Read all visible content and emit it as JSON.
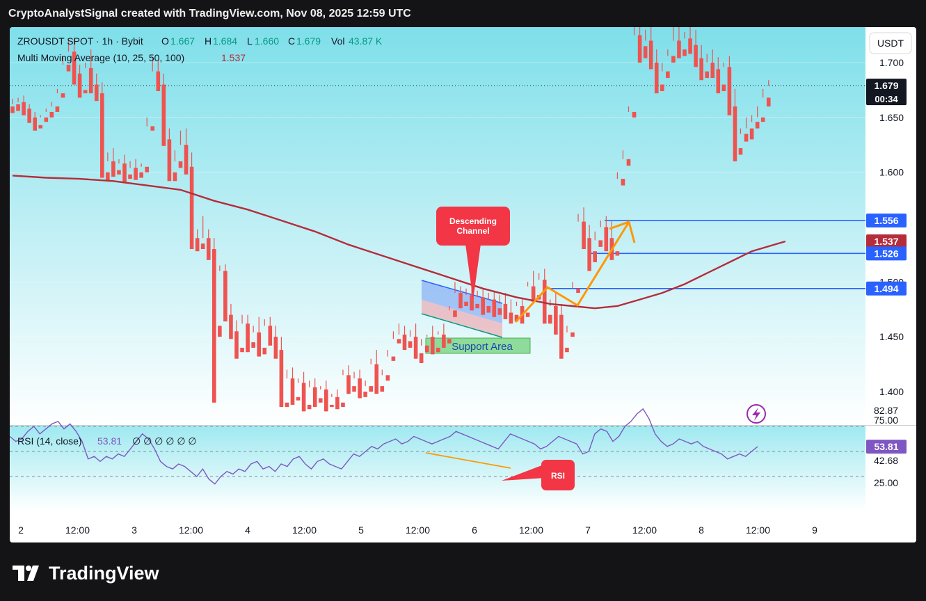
{
  "header": {
    "title": "CryptoAnalystSignal created with TradingView.com, Nov 08, 2025 12:59 UTC"
  },
  "legend": {
    "symbol": "ZROUSDT SPOT · 1h · Bybit",
    "o_label": "O",
    "o_value": "1.667",
    "h_label": "H",
    "h_value": "1.684",
    "l_label": "L",
    "l_value": "1.660",
    "c_label": "C",
    "c_value": "1.679",
    "vol_label": "Vol",
    "vol_value": "43.87 K",
    "ma_label": "Multi Moving Average (10, 25, 50, 100)",
    "ma_value": "1.537"
  },
  "currency_button": "USDT",
  "price_axis": {
    "ticks": [
      "1.700",
      "1.650",
      "1.600",
      "1.500",
      "1.450",
      "1.400"
    ]
  },
  "price_badges": {
    "last_price": "1.679",
    "countdown": "00:34",
    "level_1": "1.556",
    "ma": "1.537",
    "level_2": "1.526",
    "level_3": "1.494"
  },
  "rsi": {
    "label": "RSI (14, close)",
    "value": "53.81",
    "extras": "∅ ∅ ∅ ∅ ∅ ∅",
    "axis": [
      "82.87",
      "75.00",
      "42.68",
      "25.00"
    ],
    "badge": "53.81"
  },
  "time_axis": [
    "2",
    "12:00",
    "3",
    "12:00",
    "4",
    "12:00",
    "5",
    "12:00",
    "6",
    "12:00",
    "7",
    "12:00",
    "8",
    "12:00",
    "9"
  ],
  "annotations": {
    "descending_channel": "Descending Channel",
    "support_area": "Support Area",
    "rsi_callout": "RSI"
  },
  "footer": {
    "brand": "TradingView"
  },
  "colors": {
    "bull": "#26a69a",
    "bear": "#ef5350",
    "ma_line": "#b52c3a",
    "level_line": "#2962ff",
    "rsi_line": "#7e57c2",
    "bg_top": "#7fdde8",
    "arrow": "#ff9800",
    "callout": "#f23645"
  },
  "chart_data": {
    "type": "candlestick",
    "title": "ZROUSDT SPOT · 1h · Bybit",
    "ylim": [
      1.385,
      1.735
    ],
    "x_ticks": [
      "2",
      "12:00",
      "3",
      "12:00",
      "4",
      "12:00",
      "5",
      "12:00",
      "6",
      "12:00",
      "7",
      "12:00",
      "8",
      "12:00",
      "9"
    ],
    "candles": [
      [
        1.66,
        1.667,
        1.662,
        1.654
      ],
      [
        1.662,
        1.668,
        1.664,
        1.656
      ],
      [
        1.664,
        1.67,
        1.658,
        1.652
      ],
      [
        1.658,
        1.662,
        1.65,
        1.645
      ],
      [
        1.65,
        1.655,
        1.643,
        1.638
      ],
      [
        1.643,
        1.652,
        1.65,
        1.64
      ],
      [
        1.65,
        1.658,
        1.655,
        1.646
      ],
      [
        1.655,
        1.664,
        1.66,
        1.65
      ],
      [
        1.66,
        1.676,
        1.672,
        1.655
      ],
      [
        1.672,
        1.705,
        1.698,
        1.668
      ],
      [
        1.698,
        1.72,
        1.71,
        1.692
      ],
      [
        1.71,
        1.722,
        1.69,
        1.68
      ],
      [
        1.69,
        1.698,
        1.675,
        1.668
      ],
      [
        1.675,
        1.7,
        1.695,
        1.672
      ],
      [
        1.695,
        1.712,
        1.68,
        1.672
      ],
      [
        1.68,
        1.69,
        1.672,
        1.665
      ],
      [
        1.672,
        1.682,
        1.6,
        1.595
      ],
      [
        1.6,
        1.618,
        1.61,
        1.592
      ],
      [
        1.61,
        1.622,
        1.602,
        1.596
      ],
      [
        1.602,
        1.612,
        1.608,
        1.598
      ],
      [
        1.608,
        1.616,
        1.598,
        1.59
      ],
      [
        1.598,
        1.61,
        1.604,
        1.594
      ],
      [
        1.604,
        1.612,
        1.6,
        1.593
      ],
      [
        1.6,
        1.608,
        1.605,
        1.595
      ],
      [
        1.605,
        1.65,
        1.642,
        1.6
      ],
      [
        1.642,
        1.705,
        1.692,
        1.638
      ],
      [
        1.692,
        1.702,
        1.68,
        1.674
      ],
      [
        1.68,
        1.69,
        1.63,
        1.624
      ],
      [
        1.63,
        1.64,
        1.6,
        1.592
      ],
      [
        1.6,
        1.62,
        1.61,
        1.592
      ],
      [
        1.61,
        1.638,
        1.625,
        1.604
      ],
      [
        1.625,
        1.64,
        1.605,
        1.598
      ],
      [
        1.605,
        1.618,
        1.54,
        1.53
      ],
      [
        1.54,
        1.548,
        1.535,
        1.528
      ],
      [
        1.535,
        1.56,
        1.54,
        1.53
      ],
      [
        1.54,
        1.548,
        1.53,
        1.52
      ],
      [
        1.53,
        1.54,
        1.46,
        1.39
      ],
      [
        1.46,
        1.515,
        1.51,
        1.45
      ],
      [
        1.51,
        1.516,
        1.47,
        1.464
      ],
      [
        1.47,
        1.48,
        1.455,
        1.448
      ],
      [
        1.455,
        1.465,
        1.44,
        1.43
      ],
      [
        1.44,
        1.47,
        1.462,
        1.436
      ],
      [
        1.462,
        1.47,
        1.445,
        1.436
      ],
      [
        1.445,
        1.46,
        1.454,
        1.44
      ],
      [
        1.454,
        1.468,
        1.44,
        1.432
      ],
      [
        1.44,
        1.466,
        1.46,
        1.434
      ],
      [
        1.46,
        1.468,
        1.45,
        1.442
      ],
      [
        1.45,
        1.46,
        1.438,
        1.43
      ],
      [
        1.438,
        1.45,
        1.39,
        1.386
      ],
      [
        1.39,
        1.42,
        1.412,
        1.386
      ],
      [
        1.412,
        1.422,
        1.395,
        1.388
      ],
      [
        1.395,
        1.412,
        1.408,
        1.392
      ],
      [
        1.408,
        1.418,
        1.388,
        1.382
      ],
      [
        1.388,
        1.41,
        1.404,
        1.384
      ],
      [
        1.404,
        1.412,
        1.394,
        1.386
      ],
      [
        1.394,
        1.405,
        1.402,
        1.39
      ],
      [
        1.402,
        1.41,
        1.388,
        1.382
      ],
      [
        1.388,
        1.398,
        1.395,
        1.386
      ],
      [
        1.395,
        1.402,
        1.39,
        1.384
      ],
      [
        1.39,
        1.42,
        1.415,
        1.386
      ],
      [
        1.415,
        1.424,
        1.405,
        1.398
      ],
      [
        1.405,
        1.418,
        1.412,
        1.4
      ],
      [
        1.412,
        1.42,
        1.4,
        1.394
      ],
      [
        1.4,
        1.41,
        1.405,
        1.395
      ],
      [
        1.405,
        1.43,
        1.425,
        1.4
      ],
      [
        1.425,
        1.438,
        1.405,
        1.398
      ],
      [
        1.405,
        1.42,
        1.415,
        1.4
      ],
      [
        1.415,
        1.438,
        1.432,
        1.41
      ],
      [
        1.432,
        1.455,
        1.448,
        1.428
      ],
      [
        1.448,
        1.462,
        1.452,
        1.444
      ],
      [
        1.452,
        1.46,
        1.446,
        1.438
      ],
      [
        1.446,
        1.456,
        1.45,
        1.44
      ],
      [
        1.45,
        1.462,
        1.435,
        1.43
      ],
      [
        1.435,
        1.448,
        1.442,
        1.426
      ],
      [
        1.442,
        1.452,
        1.45,
        1.436
      ],
      [
        1.45,
        1.46,
        1.44,
        1.434
      ],
      [
        1.44,
        1.455,
        1.452,
        1.436
      ],
      [
        1.452,
        1.462,
        1.448,
        1.44
      ],
      [
        1.448,
        1.478,
        1.474,
        1.444
      ],
      [
        1.474,
        1.5,
        1.49,
        1.468
      ],
      [
        1.49,
        1.496,
        1.482,
        1.476
      ],
      [
        1.482,
        1.494,
        1.488,
        1.478
      ],
      [
        1.488,
        1.495,
        1.48,
        1.474
      ],
      [
        1.48,
        1.492,
        1.486,
        1.476
      ],
      [
        1.486,
        1.494,
        1.478,
        1.47
      ],
      [
        1.478,
        1.49,
        1.484,
        1.472
      ],
      [
        1.484,
        1.492,
        1.476,
        1.468
      ],
      [
        1.476,
        1.488,
        1.48,
        1.47
      ],
      [
        1.48,
        1.49,
        1.472,
        1.466
      ],
      [
        1.472,
        1.484,
        1.47,
        1.462
      ],
      [
        1.47,
        1.482,
        1.478,
        1.464
      ],
      [
        1.478,
        1.486,
        1.472,
        1.462
      ],
      [
        1.472,
        1.5,
        1.496,
        1.468
      ],
      [
        1.496,
        1.51,
        1.488,
        1.482
      ],
      [
        1.488,
        1.508,
        1.502,
        1.484
      ],
      [
        1.502,
        1.512,
        1.47,
        1.462
      ],
      [
        1.47,
        1.484,
        1.478,
        1.462
      ],
      [
        1.478,
        1.49,
        1.47,
        1.452
      ],
      [
        1.47,
        1.48,
        1.44,
        1.43
      ],
      [
        1.44,
        1.46,
        1.454,
        1.436
      ],
      [
        1.454,
        1.5,
        1.494,
        1.45
      ],
      [
        1.494,
        1.562,
        1.555,
        1.49
      ],
      [
        1.555,
        1.568,
        1.54,
        1.53
      ],
      [
        1.54,
        1.552,
        1.528,
        1.51
      ],
      [
        1.528,
        1.546,
        1.538,
        1.518
      ],
      [
        1.538,
        1.556,
        1.55,
        1.532
      ],
      [
        1.55,
        1.56,
        1.54,
        1.528
      ],
      [
        1.54,
        1.556,
        1.528,
        1.52
      ],
      [
        1.528,
        1.6,
        1.594,
        1.524
      ],
      [
        1.594,
        1.62,
        1.612,
        1.588
      ],
      [
        1.612,
        1.66,
        1.655,
        1.606
      ],
      [
        1.655,
        1.735,
        1.725,
        1.65
      ],
      [
        1.725,
        1.74,
        1.715,
        1.7
      ],
      [
        1.715,
        1.73,
        1.72,
        1.704
      ],
      [
        1.72,
        1.735,
        1.7,
        1.694
      ],
      [
        1.7,
        1.712,
        1.68,
        1.672
      ],
      [
        1.68,
        1.7,
        1.692,
        1.674
      ],
      [
        1.692,
        1.712,
        1.706,
        1.686
      ],
      [
        1.706,
        1.735,
        1.72,
        1.7
      ],
      [
        1.72,
        1.736,
        1.712,
        1.704
      ],
      [
        1.712,
        1.728,
        1.722,
        1.706
      ],
      [
        1.722,
        1.734,
        1.716,
        1.708
      ],
      [
        1.716,
        1.73,
        1.704,
        1.696
      ],
      [
        1.704,
        1.716,
        1.692,
        1.684
      ],
      [
        1.692,
        1.708,
        1.7,
        1.686
      ],
      [
        1.7,
        1.712,
        1.694,
        1.686
      ],
      [
        1.694,
        1.705,
        1.68,
        1.672
      ],
      [
        1.68,
        1.7,
        1.696,
        1.674
      ],
      [
        1.696,
        1.706,
        1.66,
        1.652
      ],
      [
        1.66,
        1.676,
        1.622,
        1.61
      ],
      [
        1.622,
        1.64,
        1.635,
        1.616
      ],
      [
        1.635,
        1.65,
        1.64,
        1.628
      ],
      [
        1.64,
        1.652,
        1.646,
        1.63
      ],
      [
        1.646,
        1.66,
        1.65,
        1.64
      ],
      [
        1.65,
        1.676,
        1.668,
        1.646
      ],
      [
        1.668,
        1.684,
        1.679,
        1.66
      ]
    ],
    "moving_average": [
      [
        0,
        1.597
      ],
      [
        6,
        1.595
      ],
      [
        12,
        1.594
      ],
      [
        18,
        1.592
      ],
      [
        24,
        1.588
      ],
      [
        30,
        1.584
      ],
      [
        36,
        1.574
      ],
      [
        42,
        1.566
      ],
      [
        48,
        1.556
      ],
      [
        54,
        1.546
      ],
      [
        60,
        1.534
      ],
      [
        66,
        1.524
      ],
      [
        72,
        1.514
      ],
      [
        78,
        1.504
      ],
      [
        84,
        1.494
      ],
      [
        90,
        1.486
      ],
      [
        96,
        1.48
      ],
      [
        100,
        1.478
      ],
      [
        104,
        1.476
      ],
      [
        108,
        1.478
      ],
      [
        112,
        1.484
      ],
      [
        116,
        1.49
      ],
      [
        120,
        1.498
      ],
      [
        124,
        1.508
      ],
      [
        128,
        1.518
      ],
      [
        132,
        1.528
      ],
      [
        138,
        1.537
      ]
    ],
    "levels": [
      1.556,
      1.526,
      1.494
    ],
    "rsi": {
      "name": "RSI (14, close)",
      "ylim": [
        20,
        90
      ],
      "upper": 70,
      "middle": 50,
      "lower": 30,
      "values": [
        62,
        58,
        60,
        66,
        70,
        64,
        68,
        72,
        74,
        68,
        72,
        66,
        58,
        44,
        46,
        42,
        46,
        44,
        48,
        46,
        52,
        58,
        64,
        60,
        52,
        42,
        38,
        36,
        40,
        38,
        34,
        30,
        36,
        28,
        24,
        30,
        34,
        32,
        36,
        34,
        40,
        42,
        36,
        38,
        34,
        40,
        38,
        44,
        46,
        40,
        36,
        42,
        44,
        40,
        38,
        36,
        42,
        48,
        46,
        50,
        54,
        52,
        56,
        58,
        60,
        56,
        58,
        62,
        60,
        58,
        56,
        58,
        60,
        62,
        66,
        64,
        62,
        60,
        58,
        56,
        54,
        52,
        58,
        64,
        62,
        60,
        58,
        56,
        52,
        54,
        58,
        62,
        60,
        58,
        56,
        48,
        50,
        64,
        68,
        66,
        58,
        62,
        70,
        74,
        80,
        84,
        76,
        64,
        58,
        54,
        56,
        60,
        58,
        56,
        58,
        54,
        52,
        50,
        48,
        44,
        46,
        48,
        46,
        50,
        53.81
      ]
    }
  }
}
